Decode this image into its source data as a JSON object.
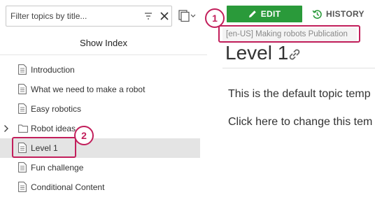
{
  "sidebar": {
    "filter_placeholder": "Filter topics by title...",
    "show_index_label": "Show Index",
    "tree": [
      {
        "label": "Introduction",
        "icon": "document-icon"
      },
      {
        "label": "What we need to make a robot",
        "icon": "document-icon"
      },
      {
        "label": "Easy robotics",
        "icon": "document-icon"
      },
      {
        "label": "Robot ideas",
        "icon": "folder-icon"
      },
      {
        "label": "Level 1",
        "icon": "document-icon",
        "selected": true
      },
      {
        "label": "Fun challenge",
        "icon": "document-icon"
      },
      {
        "label": "Conditional Content",
        "icon": "document-icon"
      }
    ]
  },
  "toolbar": {
    "edit_label": "EDIT",
    "history_label": "HISTORY"
  },
  "publication_tag": "[en-US] Making robots Publication",
  "page": {
    "title": "Level 1",
    "paragraph_1": "This is the default topic temp",
    "paragraph_2": "Click here to change this tem"
  },
  "callouts": {
    "one": "1",
    "two": "2"
  },
  "colors": {
    "accent_green": "#2a9a3a",
    "callout_magenta": "#c21f5b",
    "selected_row": "#e4e4e4"
  }
}
